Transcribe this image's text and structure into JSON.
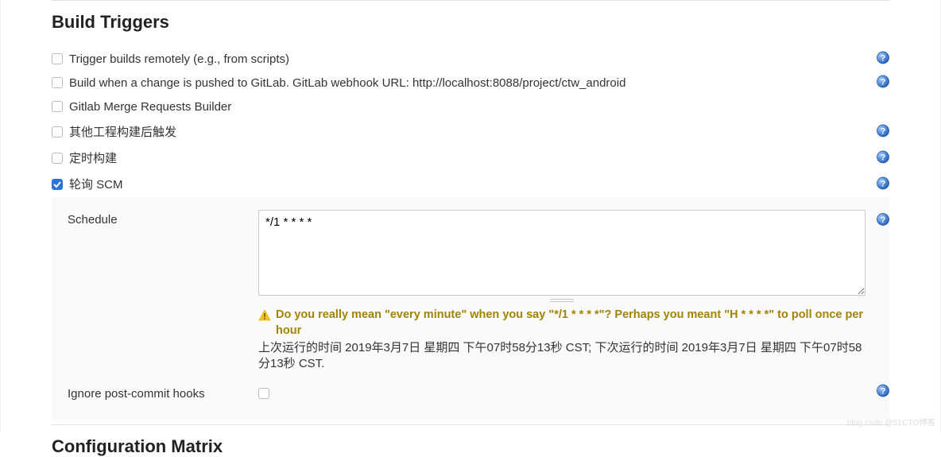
{
  "section_title": "Build Triggers",
  "triggers": [
    {
      "label": "Trigger builds remotely (e.g., from scripts)",
      "checked": false,
      "has_help": true
    },
    {
      "label": "Build when a change is pushed to GitLab. GitLab webhook URL: http://localhost:8088/project/ctw_android",
      "checked": false,
      "has_help": true
    },
    {
      "label": "Gitlab Merge Requests Builder",
      "checked": false,
      "has_help": false
    },
    {
      "label": "其他工程构建后触发",
      "checked": false,
      "has_help": true
    },
    {
      "label": "定时构建",
      "checked": false,
      "has_help": true
    },
    {
      "label": "轮询 SCM",
      "checked": true,
      "has_help": true
    }
  ],
  "schedule": {
    "label": "Schedule",
    "value": "*/1 * * * *",
    "warning": "Do you really mean \"every minute\" when you say \"*/1 * * * *\"? Perhaps you meant \"H * * * *\" to poll once per hour",
    "info": "上次运行的时间 2019年3月7日 星期四 下午07时58分13秒 CST; 下次运行的时间 2019年3月7日 星期四 下午07时58分13秒 CST."
  },
  "ignore_post_commit": {
    "label": "Ignore post-commit hooks",
    "checked": false
  },
  "next_section_title": "Configuration Matrix",
  "watermark": "blog.csdn @51CTO博客"
}
